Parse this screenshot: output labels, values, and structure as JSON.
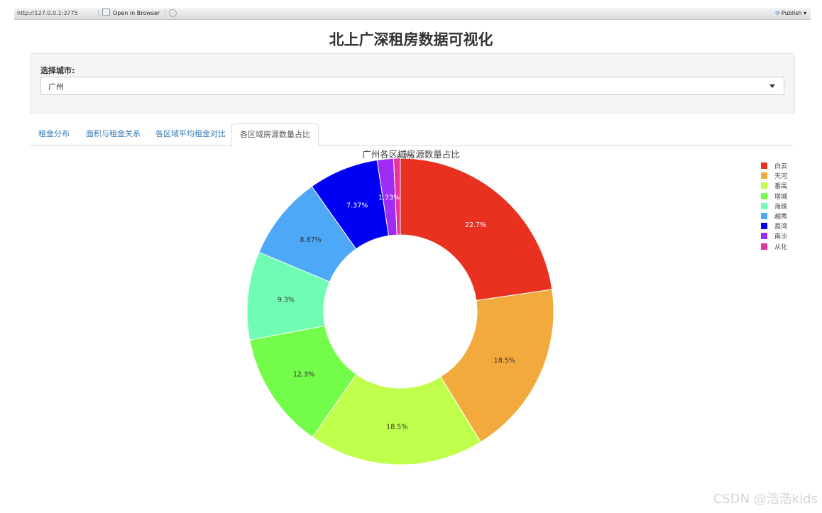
{
  "toolbar": {
    "url": "http://127.0.0.1:3775",
    "open_label": "Open in Browser",
    "publish_label": "Publish",
    "publish_caret": "▾"
  },
  "page": {
    "title": "北上广深租房数据可视化"
  },
  "filter": {
    "label": "选择城市:",
    "selected": "广州"
  },
  "tabs": [
    {
      "label": "租金分布"
    },
    {
      "label": "面积与租金关系"
    },
    {
      "label": "各区域平均租金对比"
    },
    {
      "label": "各区域房源数量占比",
      "active": true
    }
  ],
  "chart_data": {
    "type": "pie",
    "hole": 0.5,
    "title": "广州各区域房源数量占比",
    "labels": [
      "白云",
      "天河",
      "番禺",
      "增城",
      "海珠",
      "越秀",
      "荔湾",
      "南沙",
      "从化"
    ],
    "values": [
      22.7,
      18.5,
      18.5,
      12.3,
      9.3,
      8.87,
      7.37,
      1.73,
      0.7
    ],
    "text_labels": [
      "22.7%",
      "18.5%",
      "18.5%",
      "12.3%",
      "9.3%",
      "8.87%",
      "7.37%",
      "1.73%",
      "0.7%"
    ],
    "colors": [
      "#e8311f",
      "#f2aa3c",
      "#c0ff4c",
      "#74fc4a",
      "#6efdb3",
      "#4da8f7",
      "#0000f5",
      "#9f2cf5",
      "#e8339e"
    ],
    "label_colors": [
      "#ffffff",
      "#333333",
      "#333333",
      "#333333",
      "#333333",
      "#333333",
      "#ffffff",
      "#ffffff",
      "#333333"
    ],
    "legend_position": "top-right"
  },
  "watermark": "CSDN @浩浩kids"
}
